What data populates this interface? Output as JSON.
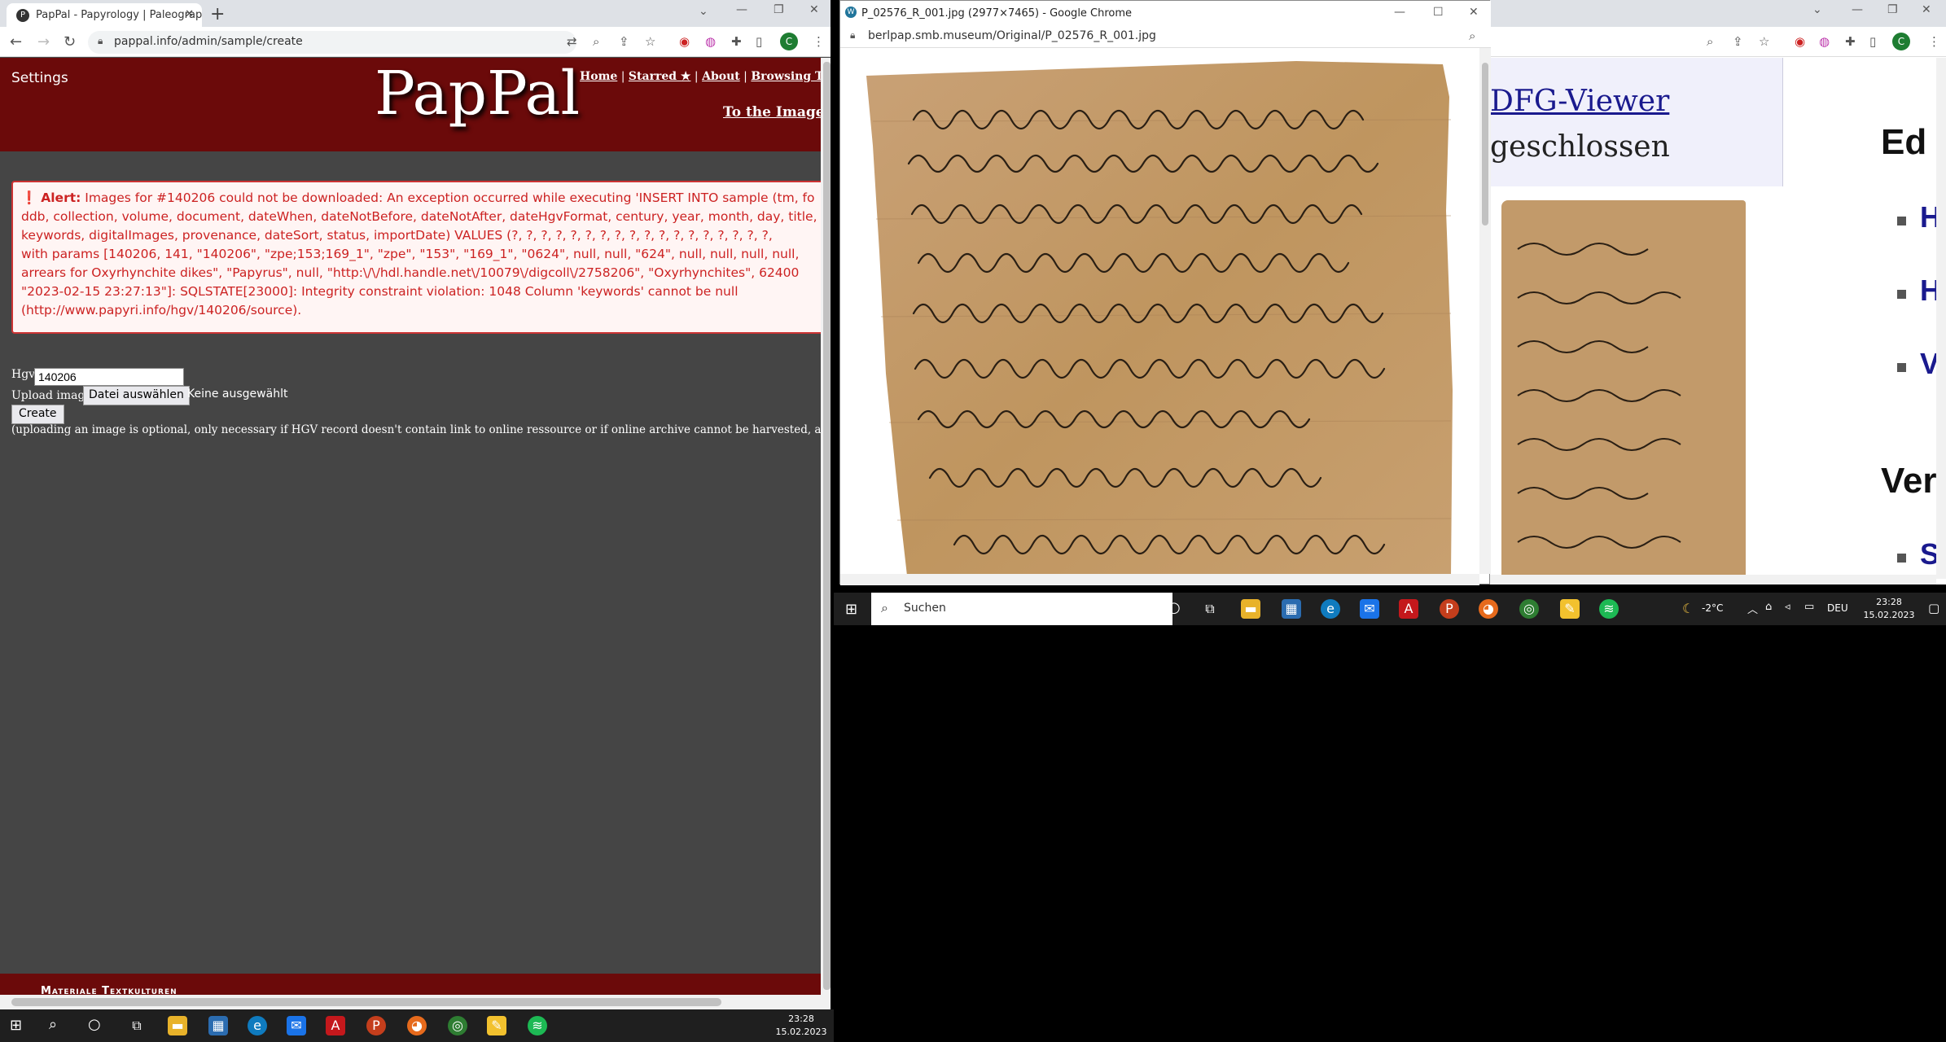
{
  "left_window": {
    "tab_title": "PapPal - Papyrology | Paleograph",
    "url": "pappal.info/admin/sample/create",
    "avatar_letter": "C",
    "page": {
      "settings": "Settings",
      "logo": "PapPal",
      "nav": [
        "Home",
        "Starred ★",
        "About",
        "Browsing Tips"
      ],
      "nav_sep": "|",
      "to_images": "To the Images ...",
      "alert_label": "Alert:",
      "alert_lines": [
        "Images for #140206 could not be downloaded: An exception occurred while executing 'INSERT INTO sample (tm, fo",
        "ddb, collection, volume, document, dateWhen, dateNotBefore, dateNotAfter, dateHgvFormat, century, year, month, day, title,",
        "keywords, digitalImages, provenance, dateSort, status, importDate) VALUES (?, ?, ?, ?, ?, ?, ?, ?, ?, ?, ?, ?, ?, ?, ?, ?, ?, ?,",
        "with params [140206, 141, \"140206\", \"zpe;153;169_1\", \"zpe\", \"153\", \"169_1\", \"0624\", null, null, \"624\", null, null, null, null,",
        "arrears for Oxyrhynchite dikes\", \"Papyrus\", null, \"http:\\/\\/hdl.handle.net\\/10079\\/digcoll\\/2758206\", \"Oxyrhynchites\", 62400",
        "\"2023-02-15 23:27:13\"]: SQLSTATE[23000]: Integrity constraint violation: 1048 Column 'keywords' cannot be null",
        "(http://www.papyri.info/hgv/140206/source)."
      ],
      "hgv_label": "Hgv",
      "hgv_value": "140206",
      "upload_label": "Upload image",
      "file_button": "Datei auswählen",
      "no_file": "Keine ausgewählt",
      "create_button": "Create",
      "note": "(uploading an image is optional, only necessary if HGV record doesn't contain link to online ressource or if online archive cannot be harvested, as is the case for",
      "footer_text": "Materiale Textkulturen"
    }
  },
  "popup_window": {
    "title": "P_02576_R_001.jpg (2977×7465) - Google Chrome",
    "url": "berlpap.smb.museum/Original/P_02576_R_001.jpg"
  },
  "right_window": {
    "link_text": "DFG-Viewer",
    "text": "geschlossen",
    "heading1": "Ed",
    "heading2": "Ver",
    "bullets": [
      "H",
      "H",
      "V"
    ],
    "bullet_bottom": "S"
  },
  "taskbar_small": {
    "search": "Suchen",
    "weather": "-2°C",
    "lang": "DEU",
    "time": "23:28",
    "date": "15.02.2023"
  },
  "taskbar_main": {
    "time": "23:28",
    "date": "15.02.2023"
  },
  "colors": {
    "banner": "#6b0a0a",
    "page_bg": "#454545",
    "alert_text": "#cc2222",
    "papyrus": "#c29a6a"
  }
}
